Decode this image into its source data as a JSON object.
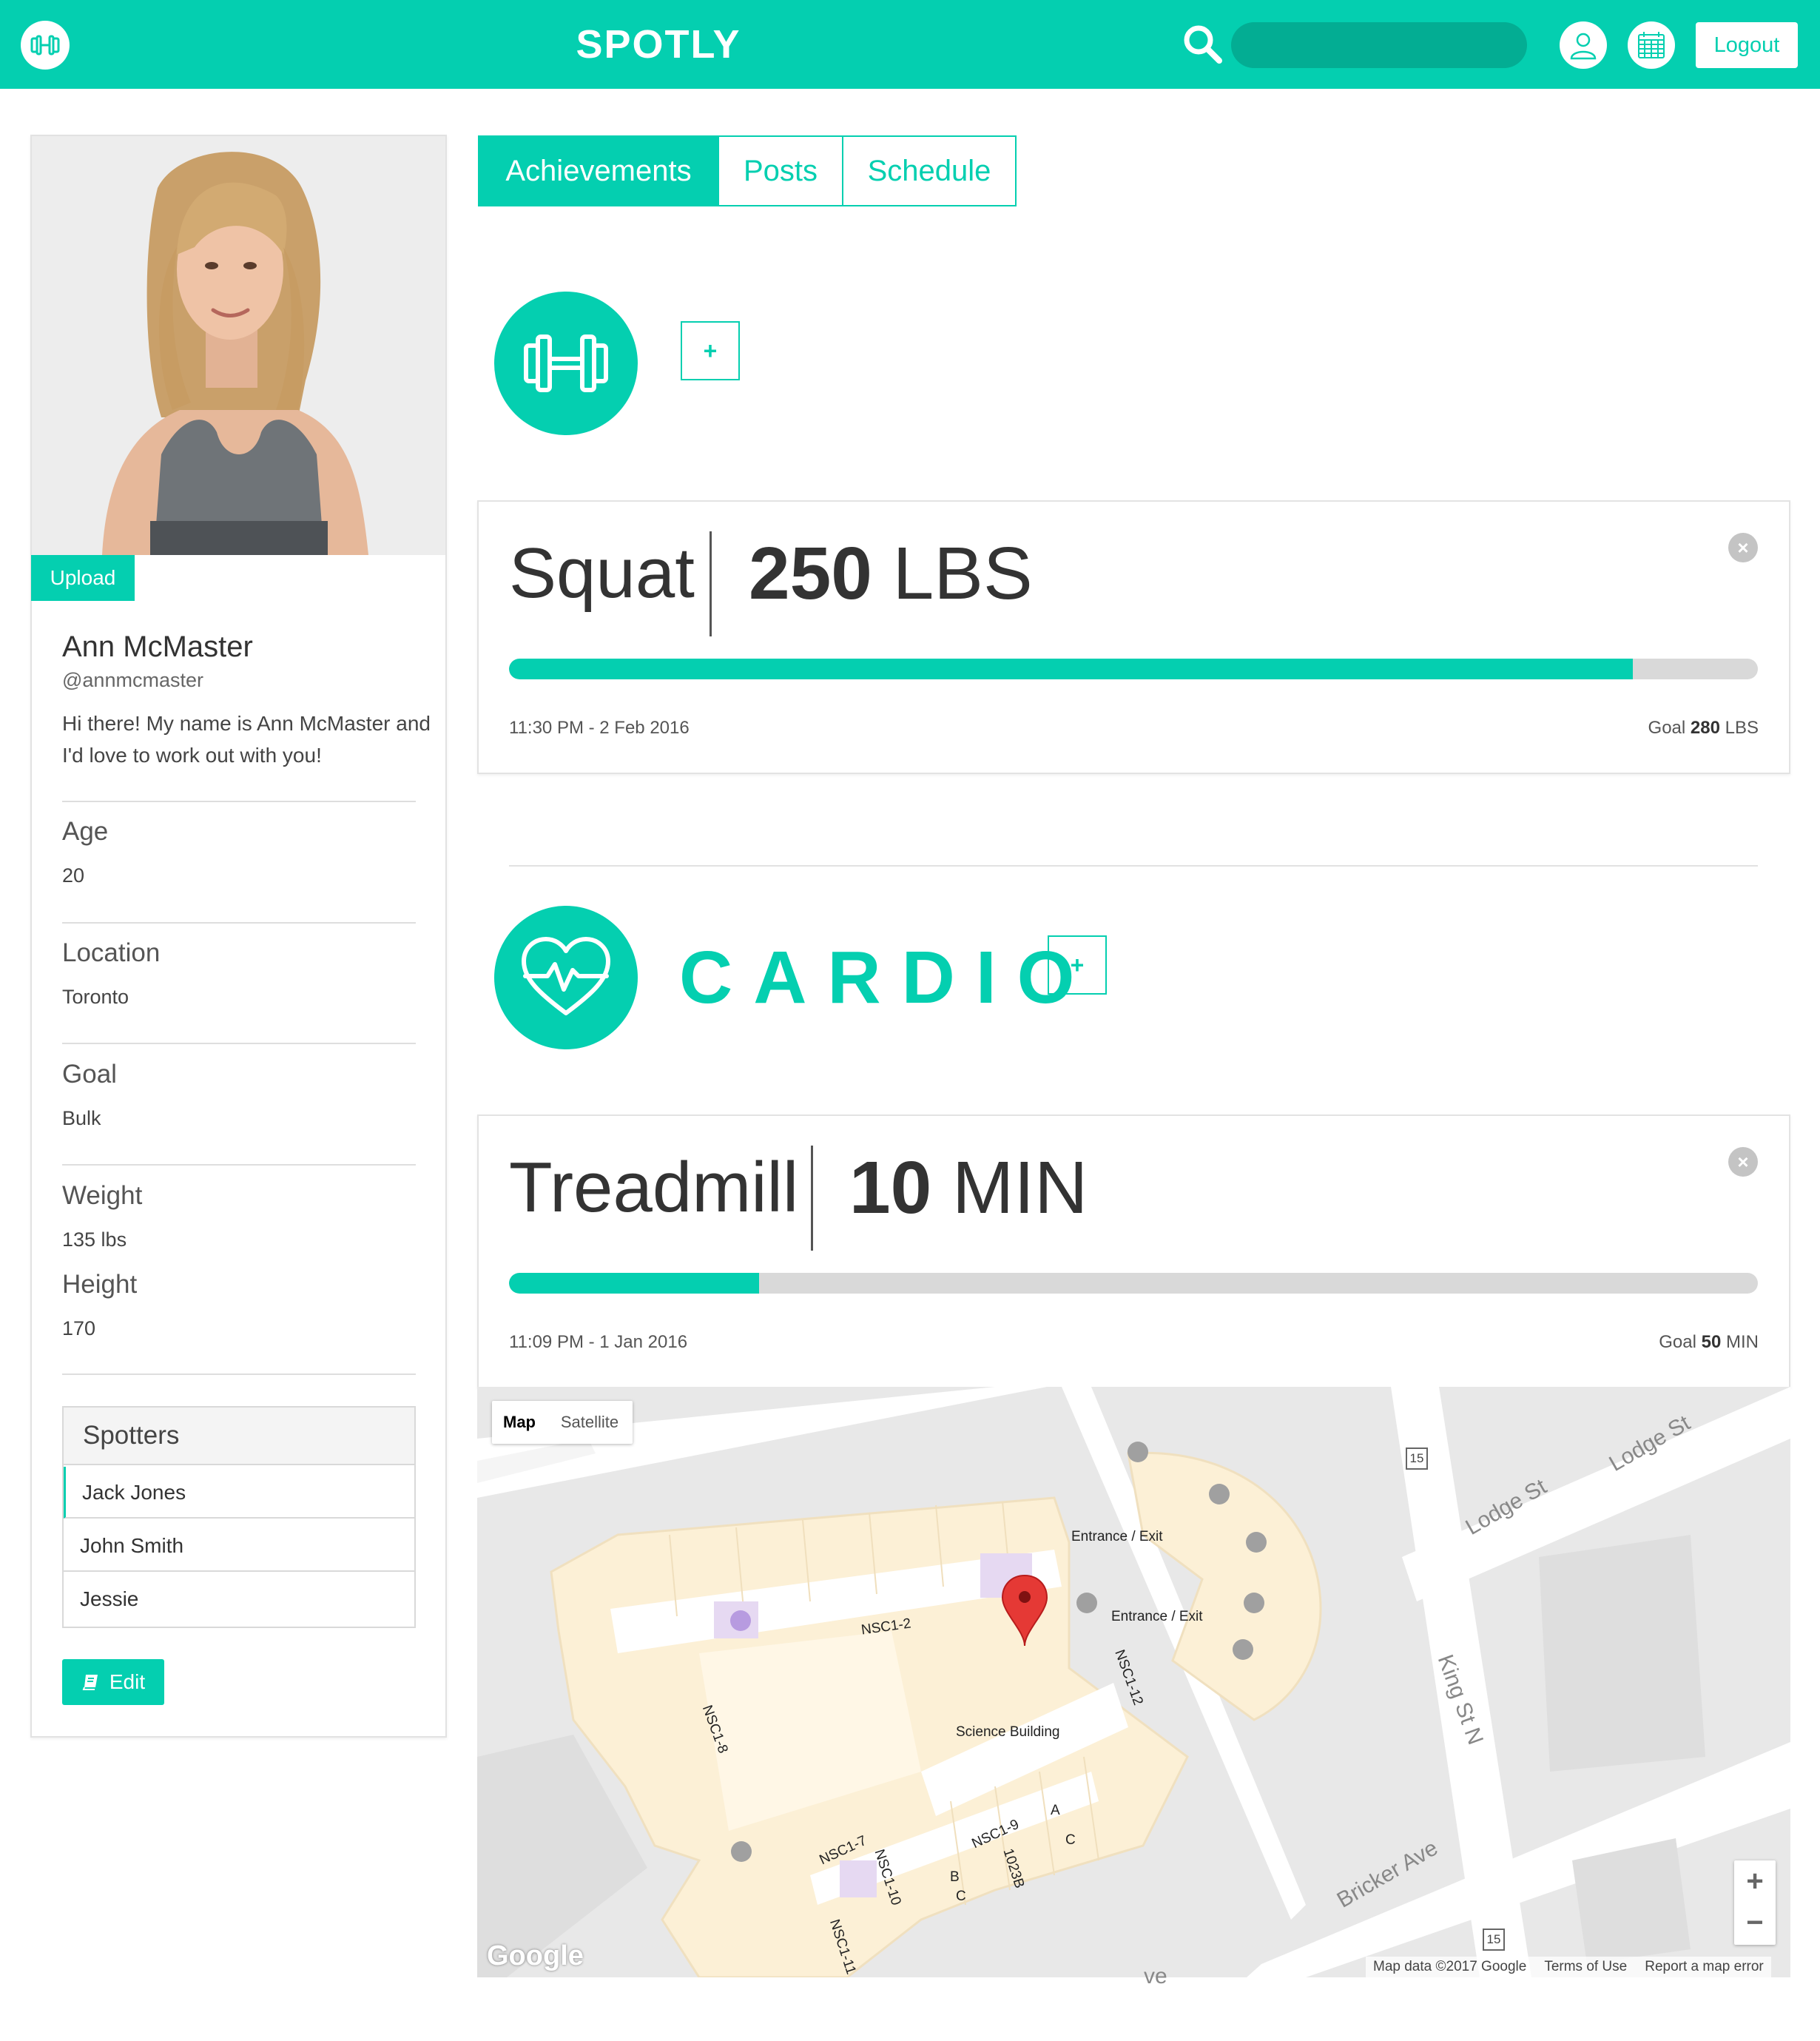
{
  "header": {
    "brand": "SPOTLY",
    "search_placeholder": "",
    "logout_label": "Logout",
    "icons": [
      "dumbbell-icon",
      "search-icon",
      "user-icon",
      "calendar-icon"
    ]
  },
  "profile": {
    "upload_label": "Upload",
    "name": "Ann McMaster",
    "handle": "@annmcmaster",
    "bio": "Hi there! My name is Ann McMaster and I'd love to work out with you!",
    "fields": [
      {
        "label": "Age",
        "value": "20"
      },
      {
        "label": "Location",
        "value": "Toronto"
      },
      {
        "label": "Goal",
        "value": "Bulk"
      },
      {
        "label": "Weight",
        "value": "135 lbs"
      },
      {
        "label": "Height",
        "value": "170"
      }
    ],
    "spotters_title": "Spotters",
    "spotters": [
      "Jack Jones",
      "John Smith",
      "Jessie"
    ],
    "edit_label": "Edit"
  },
  "tabs": [
    {
      "label": "Achievements",
      "active": true
    },
    {
      "label": "Posts",
      "active": false
    },
    {
      "label": "Schedule",
      "active": false
    }
  ],
  "sections": {
    "strength": {
      "plus_label": "+"
    },
    "cardio": {
      "title": "CARDIO",
      "plus_label": "+"
    }
  },
  "achievements": [
    {
      "name": "Squat",
      "value": "250",
      "unit": "LBS",
      "timestamp": "11:30 PM - 2 Feb 2016",
      "goal_label": "Goal",
      "goal_value": "280",
      "goal_unit": "LBS",
      "progress": 0.9
    },
    {
      "name": "Treadmill",
      "value": "10",
      "unit": "MIN",
      "timestamp": "11:09 PM - 1 Jan 2016",
      "goal_label": "Goal",
      "goal_value": "50",
      "goal_unit": "MIN",
      "progress": 0.2
    }
  ],
  "map": {
    "map_label": "Map",
    "satellite_label": "Satellite",
    "labels": [
      "Entrance / Exit",
      "Entrance / Exit",
      "NSC1-2",
      "Science Building",
      "NSC1-12",
      "NSC1-8",
      "NSC1-7",
      "NSC1-10",
      "NSC1-9",
      "1023B",
      "NSC1-11",
      "A",
      "B",
      "C",
      "C"
    ],
    "streets": [
      "Lodge St",
      "Lodge St",
      "King St N",
      "Bricker Ave",
      "ve"
    ],
    "route_shields": [
      "15",
      "15"
    ],
    "zoom_in": "+",
    "zoom_out": "−",
    "logo": "Google",
    "footer": [
      "Map data ©2017 Google",
      "Terms of Use",
      "Report a map error"
    ]
  }
}
